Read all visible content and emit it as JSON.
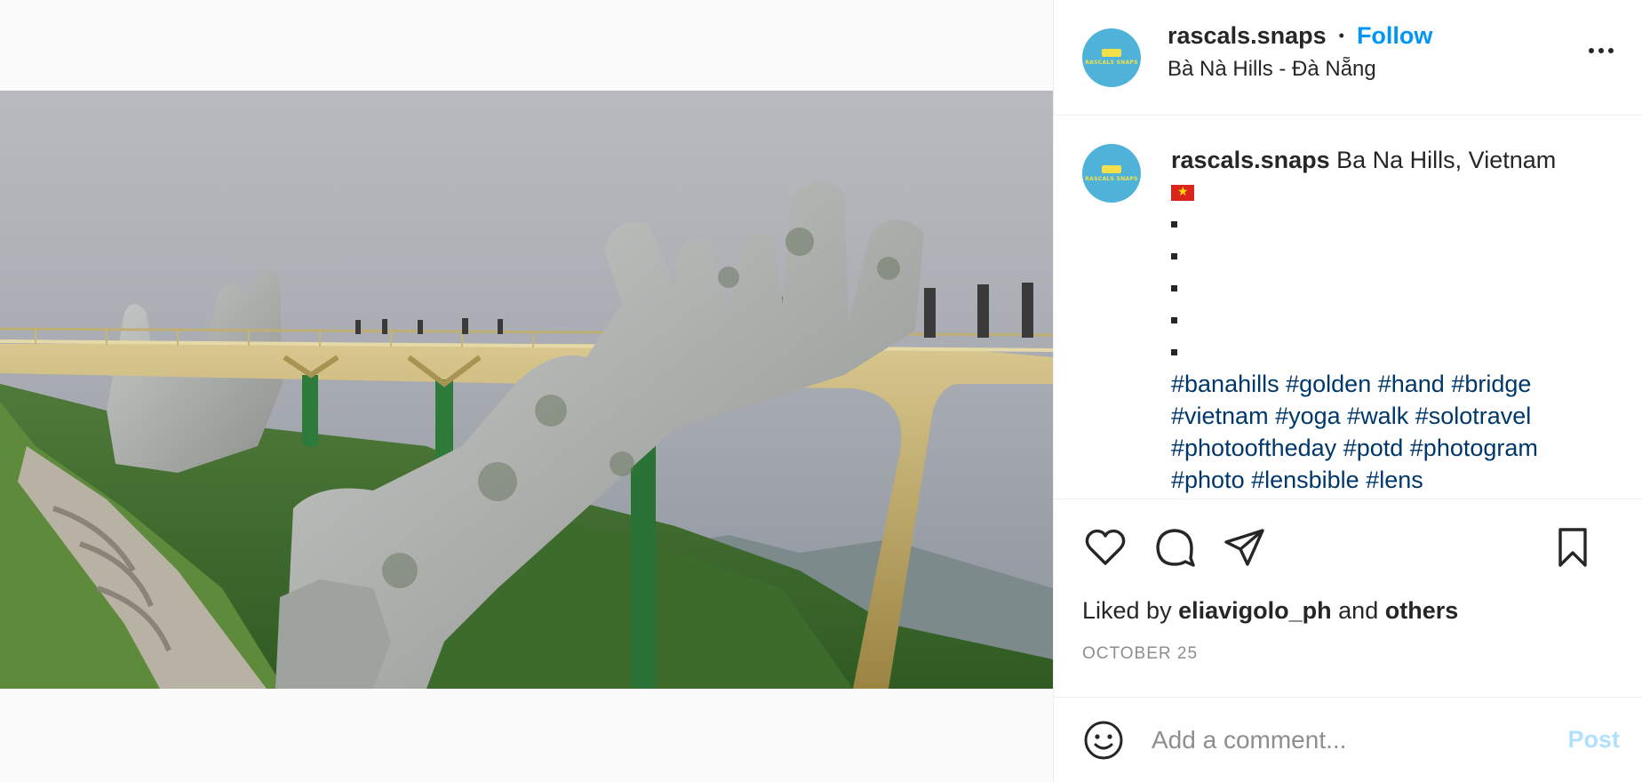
{
  "header": {
    "username": "rascals.snaps",
    "separator": "•",
    "follow_label": "Follow",
    "location": "Bà Nà Hills - Đà Nẵng",
    "avatar_text": "RASCALS SNAPS"
  },
  "caption": {
    "username": "rascals.snaps",
    "text": "Ba Na Hills, Vietnam",
    "flag": "vietnam-flag-emoji",
    "bullets": [
      "▪",
      "▪",
      "▪",
      "▪",
      "▪"
    ],
    "hashtags": [
      "#banahills",
      "#golden",
      "#hand",
      "#bridge",
      "#vietnam",
      "#yoga",
      "#walk",
      "#solotravel",
      "#photooftheday",
      "#potd",
      "#photogram",
      "#photo",
      "#lensbible",
      "#lens"
    ]
  },
  "actions": {
    "icons": [
      "heart-icon",
      "comment-icon",
      "share-icon",
      "bookmark-icon"
    ]
  },
  "likes": {
    "prefix": "Liked by",
    "user": "eliavigolo_ph",
    "connector": "and",
    "others": "others"
  },
  "date": "OCTOBER 25",
  "comment": {
    "placeholder": "Add a comment...",
    "post_label": "Post",
    "icon": "emoji-icon"
  },
  "colors": {
    "accent": "#0095f6",
    "hashtag": "#00376b",
    "post_disabled": "#b2dffc",
    "muted": "#8e8e8e"
  }
}
